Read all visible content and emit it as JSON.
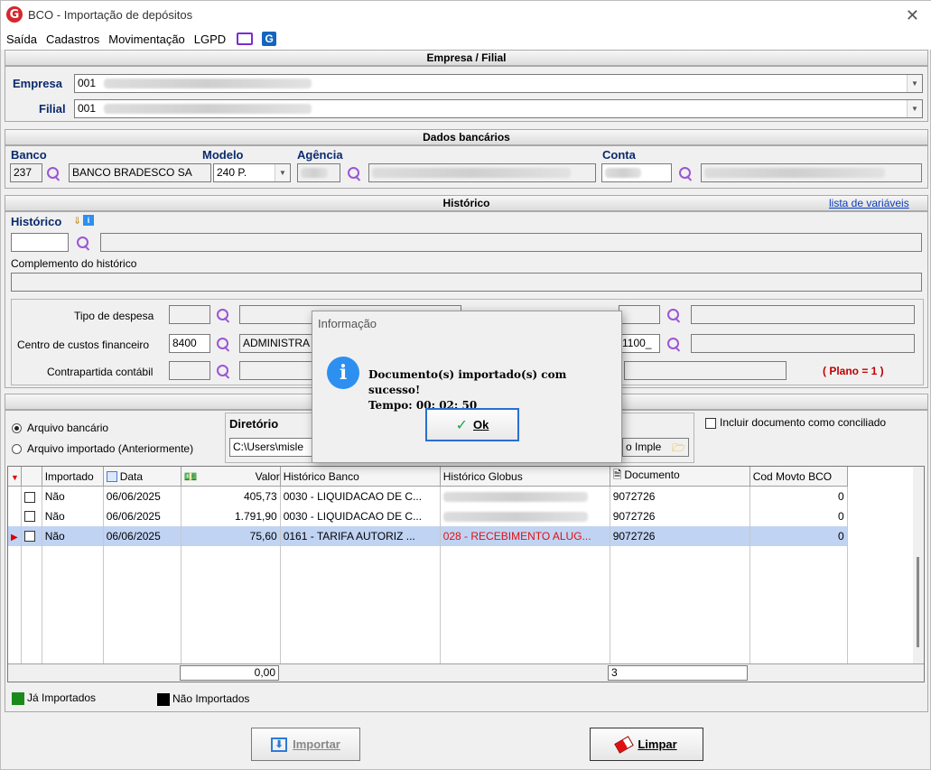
{
  "window": {
    "title": "BCO - Importação de depósitos",
    "logo_letter": "G"
  },
  "menu": [
    "Saída",
    "Cadastros",
    "Movimentação",
    "LGPD"
  ],
  "empresa_filial": {
    "header": "Empresa / Filial",
    "empresa_label": "Empresa",
    "empresa_value": "001",
    "filial_label": "Filial",
    "filial_value": "001"
  },
  "dados_bancarios": {
    "header": "Dados bancários",
    "banco_label": "Banco",
    "banco_code": "237",
    "banco_name": "BANCO BRADESCO SA",
    "modelo_label": "Modelo",
    "modelo_value": "240 P.",
    "agencia_label": "Agência",
    "conta_label": "Conta"
  },
  "historico": {
    "header": "Histórico",
    "lista_link": "lista de variáveis",
    "historico_label": "Histórico",
    "complemento_label": "Complemento do histórico",
    "tipo_despesa_label": "Tipo de despesa",
    "centro_custos_label": "Centro de custos financeiro",
    "centro_custos_code": "8400",
    "centro_custos_name": "ADMINISTRA",
    "contrapartida_label": "Contrapartida contábil",
    "right_code": "1100_",
    "plano_text": "( Plano = 1 )"
  },
  "import": {
    "radio_arquivo_bancario": "Arquivo bancário",
    "radio_arquivo_importado": "Arquivo importado (Anteriormente)",
    "diretorio_label": "Diretório",
    "diretorio_value": "C:\\Users\\misle",
    "arquivo_partial": "o Imple",
    "incluir_label": "Incluir documento como conciliado"
  },
  "grid": {
    "columns": [
      "Importado",
      "Data",
      "Valor",
      "Histórico Banco",
      "Histórico Globus",
      "Documento",
      "Cod Movto BCO"
    ],
    "rows": [
      {
        "importado": "Não",
        "data": "06/06/2025",
        "valor": "405,73",
        "hist_banco": "0030 - LIQUIDACAO DE C...",
        "hist_globus": "",
        "documento": "9072726",
        "cod": "0"
      },
      {
        "importado": "Não",
        "data": "06/06/2025",
        "valor": "1.791,90",
        "hist_banco": "0030 - LIQUIDACAO DE C...",
        "hist_globus": "",
        "documento": "9072726",
        "cod": "0"
      },
      {
        "importado": "Não",
        "data": "06/06/2025",
        "valor": "75,60",
        "hist_banco": "0161 - TARIFA AUTORIZ ...",
        "hist_globus": "028 - RECEBIMENTO ALUG...",
        "documento": "9072726",
        "cod": "0"
      }
    ],
    "total_valor": "0,00",
    "total_documento": "3"
  },
  "legend": {
    "ja_importados": "Já Importados",
    "nao_importados": "Não Importados",
    "green": "#1a8a1a",
    "black": "#000000"
  },
  "buttons": {
    "importar": "Importar",
    "limpar": "Limpar"
  },
  "dialog": {
    "title": "Informação",
    "line1": "Documento(s) importado(s) com sucesso!",
    "line2": "Tempo: 00: 02: 50",
    "ok": "Ok"
  }
}
